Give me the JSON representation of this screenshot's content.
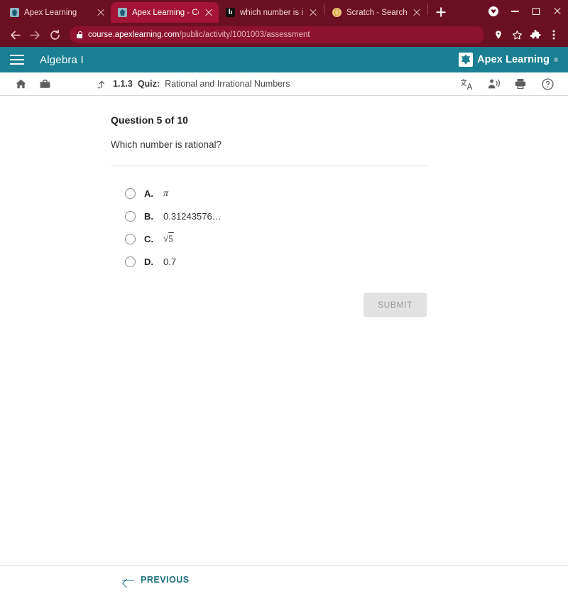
{
  "browser": {
    "tabs": [
      {
        "title": "Apex Learning",
        "favicon": "apex-favicon",
        "active": false
      },
      {
        "title": "Apex Learning - Course",
        "favicon": "apex-favicon",
        "active": true
      },
      {
        "title": "which number is irratio",
        "favicon": "bing-favicon",
        "active": false
      },
      {
        "title": "Scratch - Search",
        "favicon": "scratch-favicon",
        "active": false
      }
    ],
    "new_tab_label": "+",
    "window_controls": {
      "profile": "profile-avatar",
      "minimize": "minimize",
      "maximize": "maximize",
      "close": "close"
    },
    "nav": {
      "back": "←",
      "forward": "→",
      "reload": "⟳"
    },
    "omnibox": {
      "lock": "secure-lock",
      "host": "course.apexlearning.com",
      "path": "/public/activity/1001003/assessment"
    },
    "toolbar_icons": [
      "location-icon",
      "bookmark-star-icon",
      "extensions-icon",
      "chrome-menu-icon"
    ]
  },
  "app": {
    "header": {
      "menu_label": "menu",
      "course_title": "Algebra I",
      "brand_name": "Apex Learning",
      "brand_tm": "®",
      "accent_teal": "#1b7f93"
    },
    "subheader": {
      "home_icon": "home-icon",
      "briefcase_icon": "briefcase-icon",
      "return_icon": "return-up-icon",
      "activity_number": "1.1.3",
      "activity_kind": "Quiz:",
      "activity_name": "Rational and Irrational Numbers",
      "tools": [
        "translate-icon",
        "read-aloud-icon",
        "print-icon",
        "help-icon"
      ]
    }
  },
  "question": {
    "heading": "Question 5 of 10",
    "prompt": "Which number is rational?",
    "options": [
      {
        "letter": "A.",
        "value": "π",
        "kind": "pi",
        "selected": false
      },
      {
        "letter": "B.",
        "value": "0.31243576…",
        "kind": "plain",
        "selected": false
      },
      {
        "letter": "C.",
        "value": "√5",
        "kind": "radical",
        "radicand": "5",
        "selected": false
      },
      {
        "letter": "D.",
        "value": "0.7",
        "kind": "plain",
        "selected": false
      }
    ],
    "submit_label": "SUBMIT",
    "submit_enabled": false
  },
  "footer": {
    "previous_label": "PREVIOUS"
  },
  "colors": {
    "browser_chrome": "#6b0f22",
    "active_tab": "#a31436",
    "omnibox": "#8c1230",
    "app_teal": "#1b7f93",
    "link_teal": "#20717f",
    "submit_disabled_bg": "#e2e2e2"
  }
}
